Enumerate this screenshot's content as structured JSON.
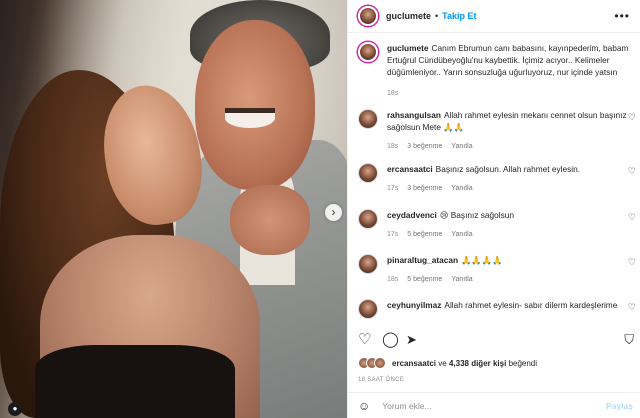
{
  "post": {
    "username": "guclumete",
    "separator": "•",
    "follow_label": "Takip Et",
    "more_label": "•••",
    "caption": "Canım Ebrumun canı babasını, kayınpederim, babam Ertuğrul Cündübeyoğlu'nu kaybettik. İçimiz acıyor.. Kelimeler düğümleniyor.. Yarın sonsuzluğa uğurluyoruz, nur içinde yatsın",
    "caption_time": "18s"
  },
  "comments": [
    {
      "user": "rahsangulsan",
      "text": "Allah rahmet eylesin mekanı cennet olsun başınız sağolsun Mete 🙏🙏",
      "time": "18s",
      "likes": "3 beğenme",
      "reply": "Yanıtla"
    },
    {
      "user": "ercansaatci",
      "text": "Başınız sağolsun. Allah rahmet eylesin.",
      "time": "17s",
      "likes": "3 beğenme",
      "reply": "Yanıtla"
    },
    {
      "user": "ceydadvenci",
      "text": "😢 Başınız sağolsun",
      "time": "17s",
      "likes": "5 beğenme",
      "reply": "Yanıtla"
    },
    {
      "user": "pinaraltug_atacan",
      "text": "🙏🙏🙏🙏",
      "time": "18s",
      "likes": "5 beğenme",
      "reply": "Yanıtla"
    },
    {
      "user": "ceyhunyilmaz",
      "text": "Allah rahmet eylesin- sabır dilerm kardeşlerime",
      "time": "",
      "likes": "",
      "reply": ""
    }
  ],
  "likes_line": {
    "user": "ercansaatci",
    "connector": "ve",
    "others": "4,338 diğer kişi",
    "suffix": "beğendi"
  },
  "time_ago": "18 SAAT ÖNCE",
  "composer": {
    "emoji_icon": "☺",
    "placeholder": "Yorum ekle...",
    "post_label": "Paylaş"
  },
  "icons": {
    "heart": "♡",
    "comment": "◯",
    "share": "➤",
    "bookmark": "⛉",
    "next": "›",
    "tag": "●"
  }
}
